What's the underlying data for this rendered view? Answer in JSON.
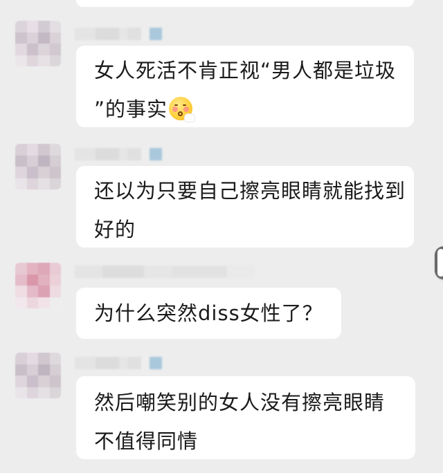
{
  "messages": [
    {
      "lines": [
        "女人死活不肯正视“男人都是垃圾",
        "”的事实"
      ],
      "emoji": "face-with-hand-over-mouth-blush"
    },
    {
      "lines": [
        "还以为只要自己擦亮眼睛就能找到",
        "好的"
      ]
    },
    {
      "lines": [
        "为什么突然diss女性了？"
      ]
    },
    {
      "lines": [
        "然后嘲笑别的女人没有擦亮眼睛",
        "不值得同情"
      ]
    }
  ],
  "colors": {
    "background": "#ededed",
    "bubble": "#ffffff",
    "text": "#1a1a1a"
  }
}
